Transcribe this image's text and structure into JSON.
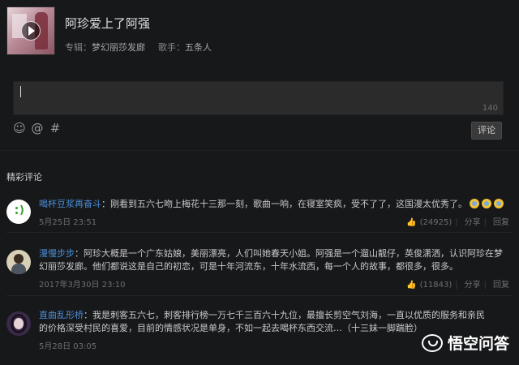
{
  "song": {
    "title": "阿珍爱上了阿强",
    "album_label": "专辑：",
    "album": "梦幻丽莎发廊",
    "singer_label": "歌手：",
    "singer": "五条人"
  },
  "editor": {
    "count": "140",
    "submit": "评论"
  },
  "tools": {
    "emoji": "☺",
    "at": "@",
    "hash": "#"
  },
  "section_title": "精彩评论",
  "comments": [
    {
      "user": "喝杯豆浆再奋斗",
      "text": "刚看到五六七吻上梅花十三那一刻，歌曲一响，在寝室笑疯，受不了了，这国漫太优秀了。",
      "time": "5月25日 23:51",
      "likes": "(24925)",
      "share": "分享",
      "reply": "回复"
    },
    {
      "user": "漫慢步步",
      "text": "阿珍大概是一个广东姑娘，美丽漂亮，人们叫她春天小姐。阿强是一个遛山靓仔，英俊潇洒，认识阿珍在梦幻丽莎发廊。他们都说这是自己的初恋，可是十年河流东，十年水流西，每一个人的故事，都很多，很多。",
      "time": "2017年3月30日 23:10",
      "likes": "(11843)",
      "share": "分享",
      "reply": "回复"
    },
    {
      "user": "直曲乱形桥",
      "text": "我是刺客五六七，刺客排行榜一万七千三百六十九位，最擅长剪空气刘海，一直以优质的服务和亲民的价格深受村民的喜爱，目前的情感状况是单身，不如一起去喝杯东西交流…（十三妹一脚踹脸）",
      "time": "5月28日 03:05"
    }
  ],
  "watermark": "悟空问答"
}
